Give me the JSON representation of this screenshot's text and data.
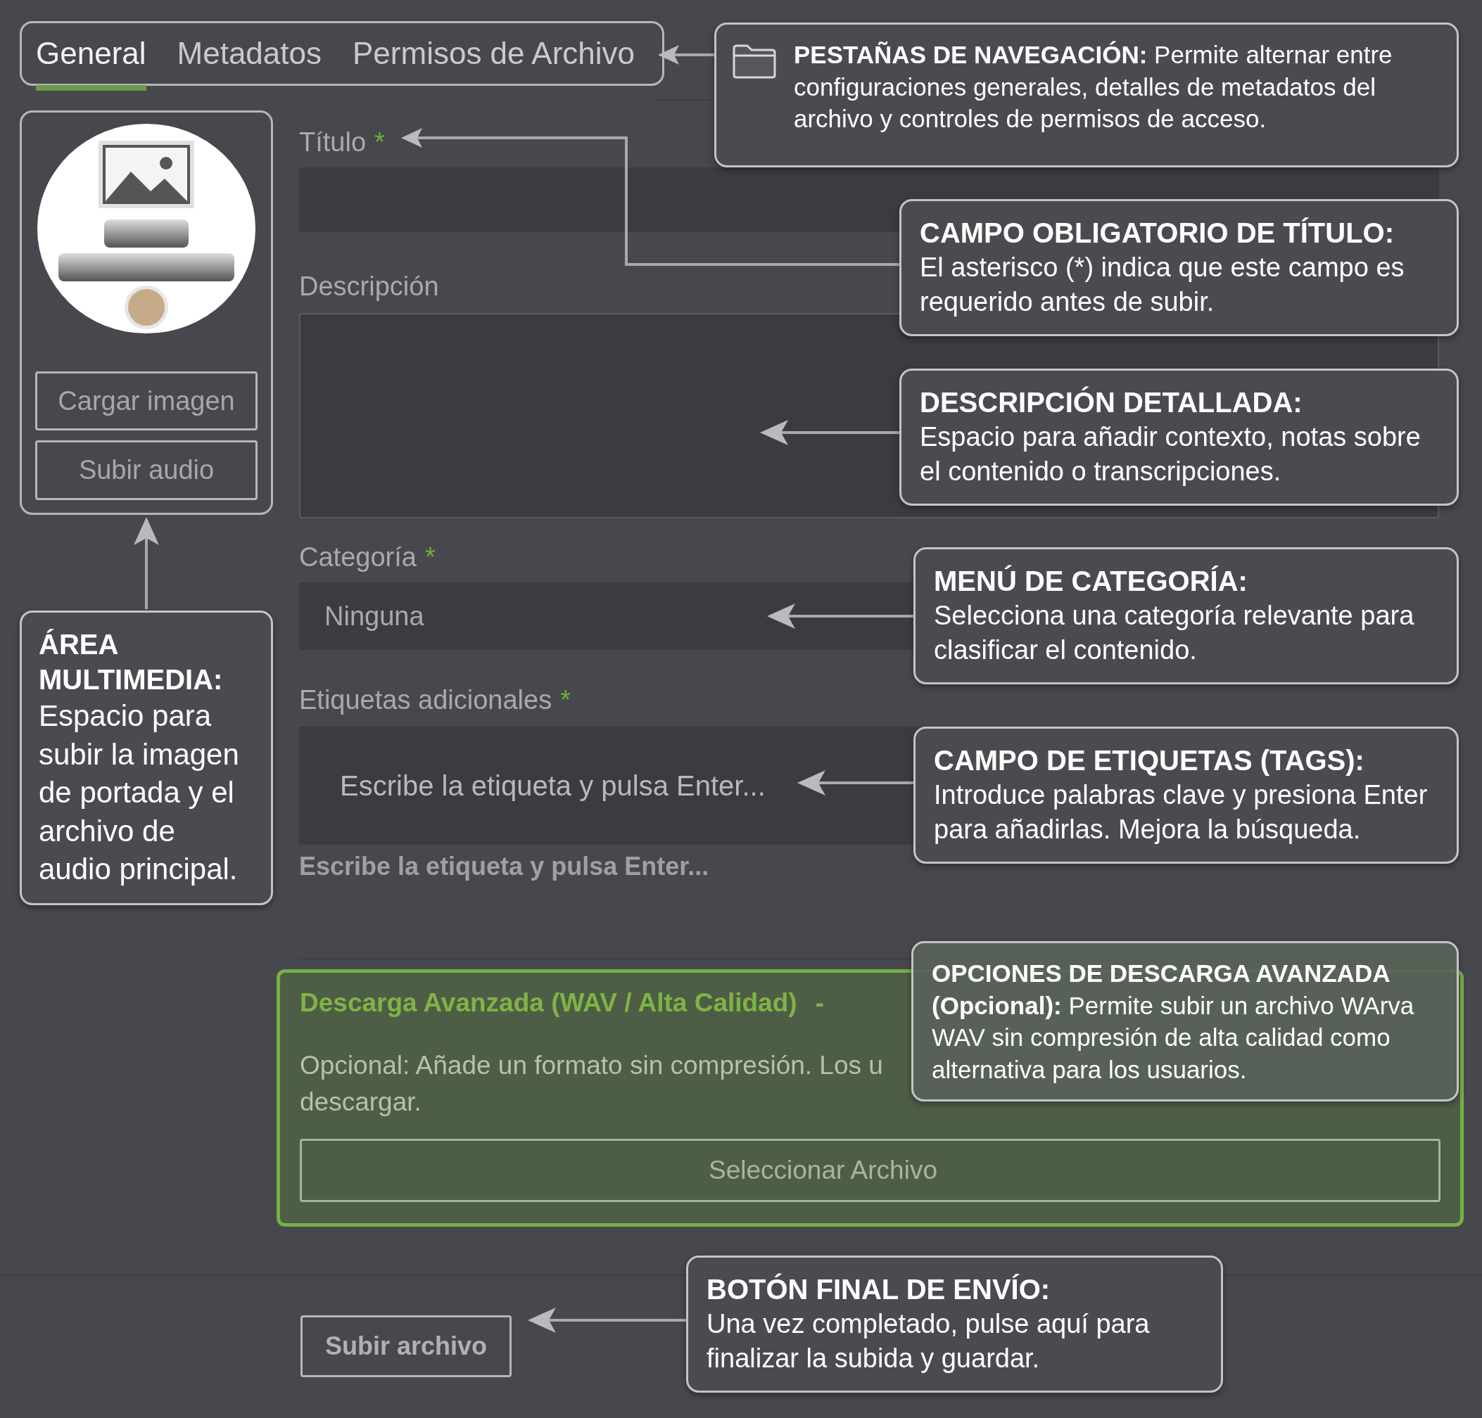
{
  "tabs": [
    {
      "label": "General",
      "selected": true
    },
    {
      "label": "Metadatos",
      "selected": false
    },
    {
      "label": "Permisos de Archivo",
      "selected": false
    }
  ],
  "media": {
    "buttons": [
      "Cargar imagen",
      "Subir audio"
    ]
  },
  "form": {
    "title_field": {
      "label": "Título",
      "required_mark": "*"
    },
    "description_field": {
      "label": "Descripción"
    },
    "category_field": {
      "label": "Categoría",
      "required_mark": "*",
      "value": "Ninguna"
    },
    "tags_field": {
      "label": "Etiquetas adicionales",
      "required_mark": "*",
      "placeholder": "Escribe la etiqueta y pulsa Enter...",
      "hint": "Escribe la etiqueta y pulsa Enter..."
    }
  },
  "advanced_download": {
    "title": "Descarga Avanzada (WAV / Alta Calidad)",
    "toggle": "-",
    "description_lines": [
      "Opcional: Añade un formato sin compresión. Los u",
      "descargar."
    ],
    "button": "Seleccionar Archivo"
  },
  "submit_button": "Subir archivo",
  "callouts": [
    {
      "kind": "tabs",
      "text": "**PESTAÑAS DE NAVEGACIÓN:** Permite alternar entre configuraciones generales, detalles de metadatos del archivo y controles de permisos de acceso."
    },
    {
      "kind": "title",
      "title": "CAMPO OBLIGATORIO DE TÍTULO:",
      "text": "El asterisco (*) indica que este campo es requerido antes de subir."
    },
    {
      "kind": "description",
      "title": "DESCRIPCIÓN DETALLADA:",
      "text": "Espacio para añadir contexto, notas sobre el contenido o transcripciones."
    },
    {
      "kind": "category",
      "title": "MENÚ DE CATEGORÍA:",
      "text": "Selecciona una categoría relevante para clasificar el contenido."
    },
    {
      "kind": "tags",
      "title": "CAMPO DE ETIQUETAS (TAGS):",
      "text": "Introduce palabras clave y presiona Enter para añadirlas. Mejora la búsqueda."
    },
    {
      "kind": "advanced",
      "text": "**OPCIONES DE DESCARGA AVANZADA (Opcional):** Permite subir un archivo WArva WAV sin compresión de alta calidad como alternativa para los usuarios."
    },
    {
      "kind": "submit",
      "title": "BOTÓN FINAL DE ENVÍO:",
      "text": "Una vez completado, pulse aquí para finalizar la subida y guardar."
    },
    {
      "kind": "media",
      "title": "ÁREA MULTIMEDIA:",
      "text": "Espacio para subir la imagen de portada y el archivo de audio principal."
    }
  ]
}
